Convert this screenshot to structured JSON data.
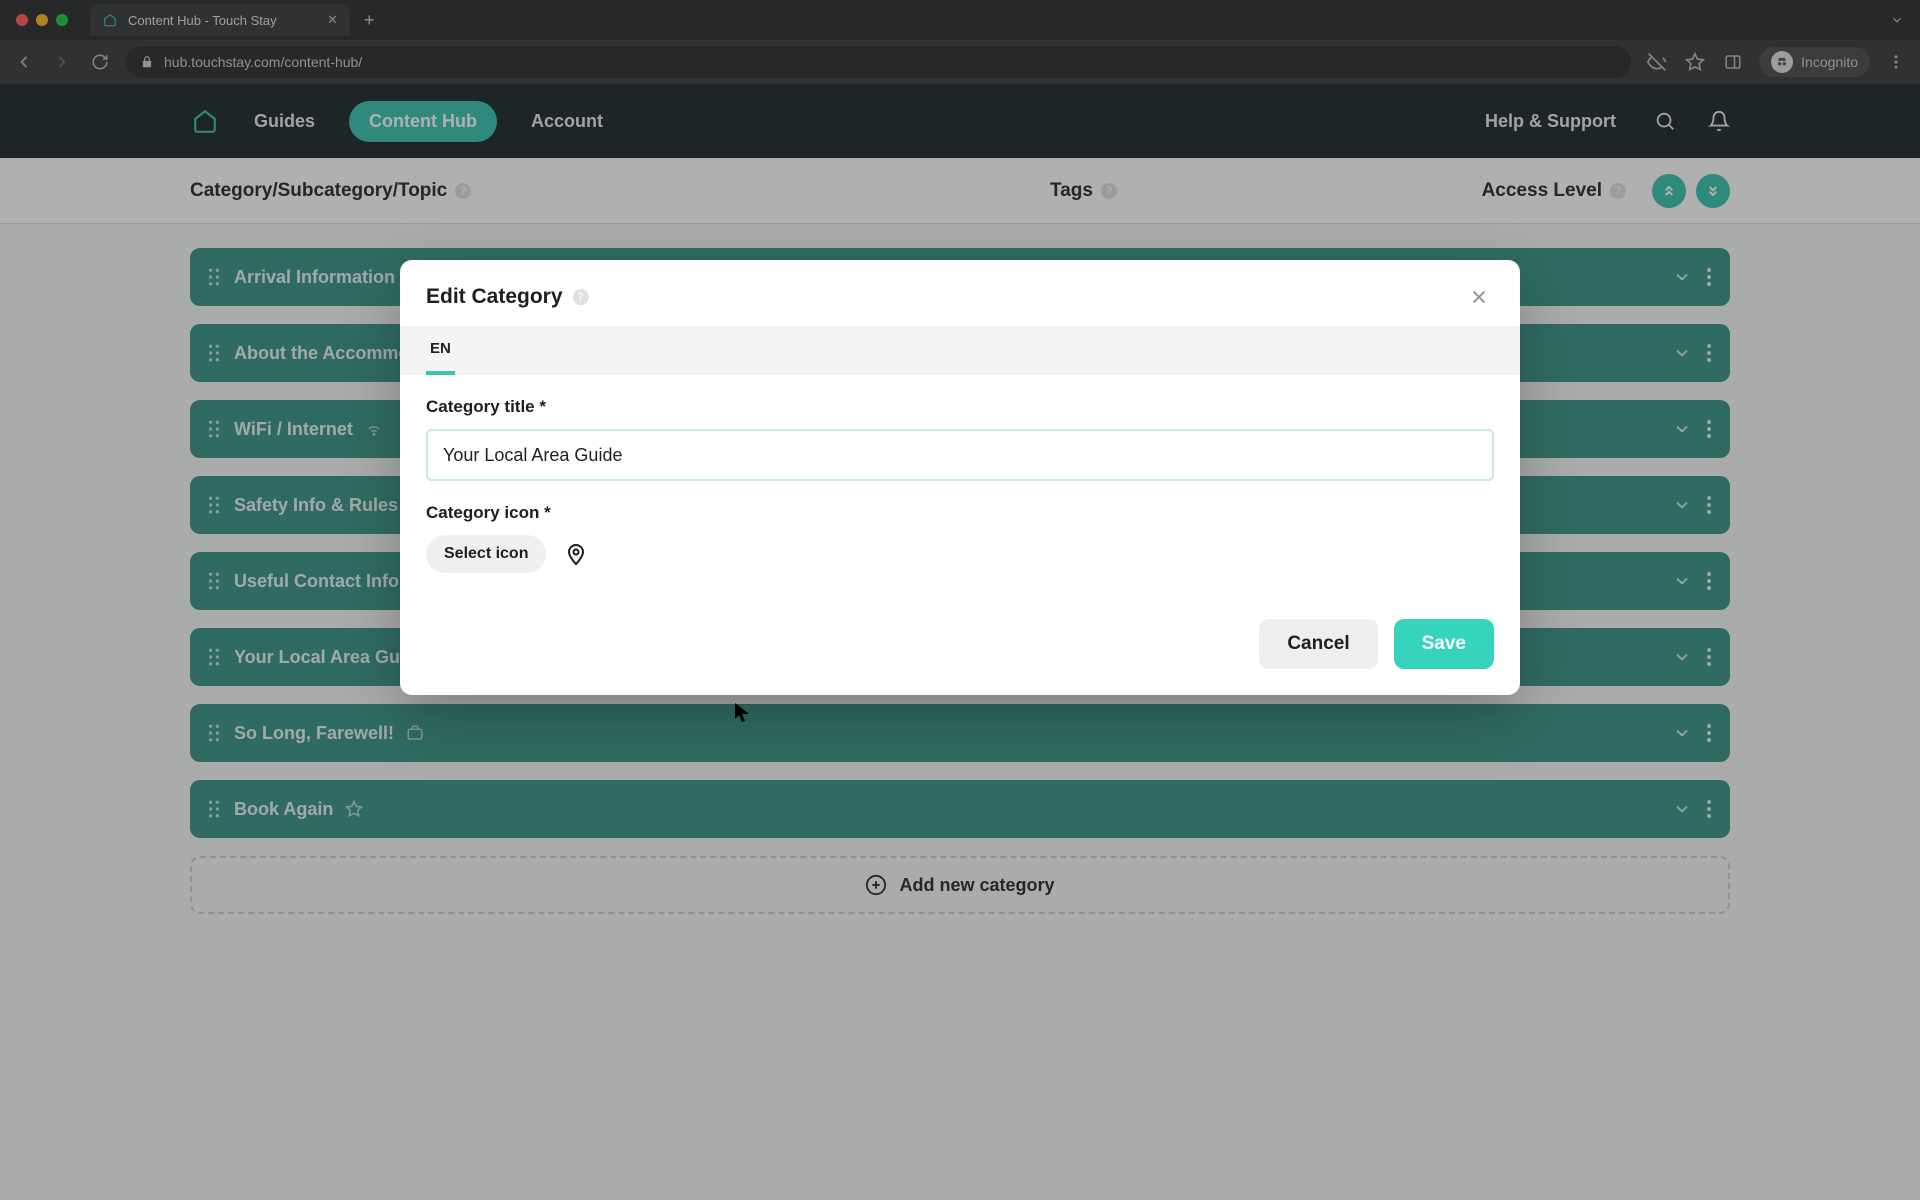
{
  "browser": {
    "tab_title": "Content Hub - Touch Stay",
    "url": "hub.touchstay.com/content-hub/",
    "incognito_label": "Incognito"
  },
  "nav": {
    "items": [
      "Guides",
      "Content Hub",
      "Account"
    ],
    "active_index": 1,
    "help_label": "Help & Support"
  },
  "columns": {
    "c1": "Category/Subcategory/Topic",
    "c2": "Tags",
    "c3": "Access Level"
  },
  "categories": [
    {
      "title": "Arrival Information",
      "icon": "plane"
    },
    {
      "title": "About the Accommodation",
      "icon": "home"
    },
    {
      "title": "WiFi / Internet",
      "icon": "wifi"
    },
    {
      "title": "Safety Info & Rules",
      "icon": "shield"
    },
    {
      "title": "Useful Contact Information",
      "icon": "phone"
    },
    {
      "title": "Your Local Area Guide",
      "icon": "pin"
    },
    {
      "title": "So Long, Farewell!",
      "icon": "suitcase"
    },
    {
      "title": "Book Again",
      "icon": "star"
    }
  ],
  "add_new_label": "Add new category",
  "modal": {
    "title": "Edit Category",
    "lang_tab": "EN",
    "field_title_label": "Category title *",
    "field_title_value": "Your Local Area Guide",
    "field_icon_label": "Category icon *",
    "select_icon_label": "Select icon",
    "cancel_label": "Cancel",
    "save_label": "Save"
  },
  "colors": {
    "accent": "#3ac4b0",
    "row": "#3a9688",
    "save": "#36d3bd"
  }
}
